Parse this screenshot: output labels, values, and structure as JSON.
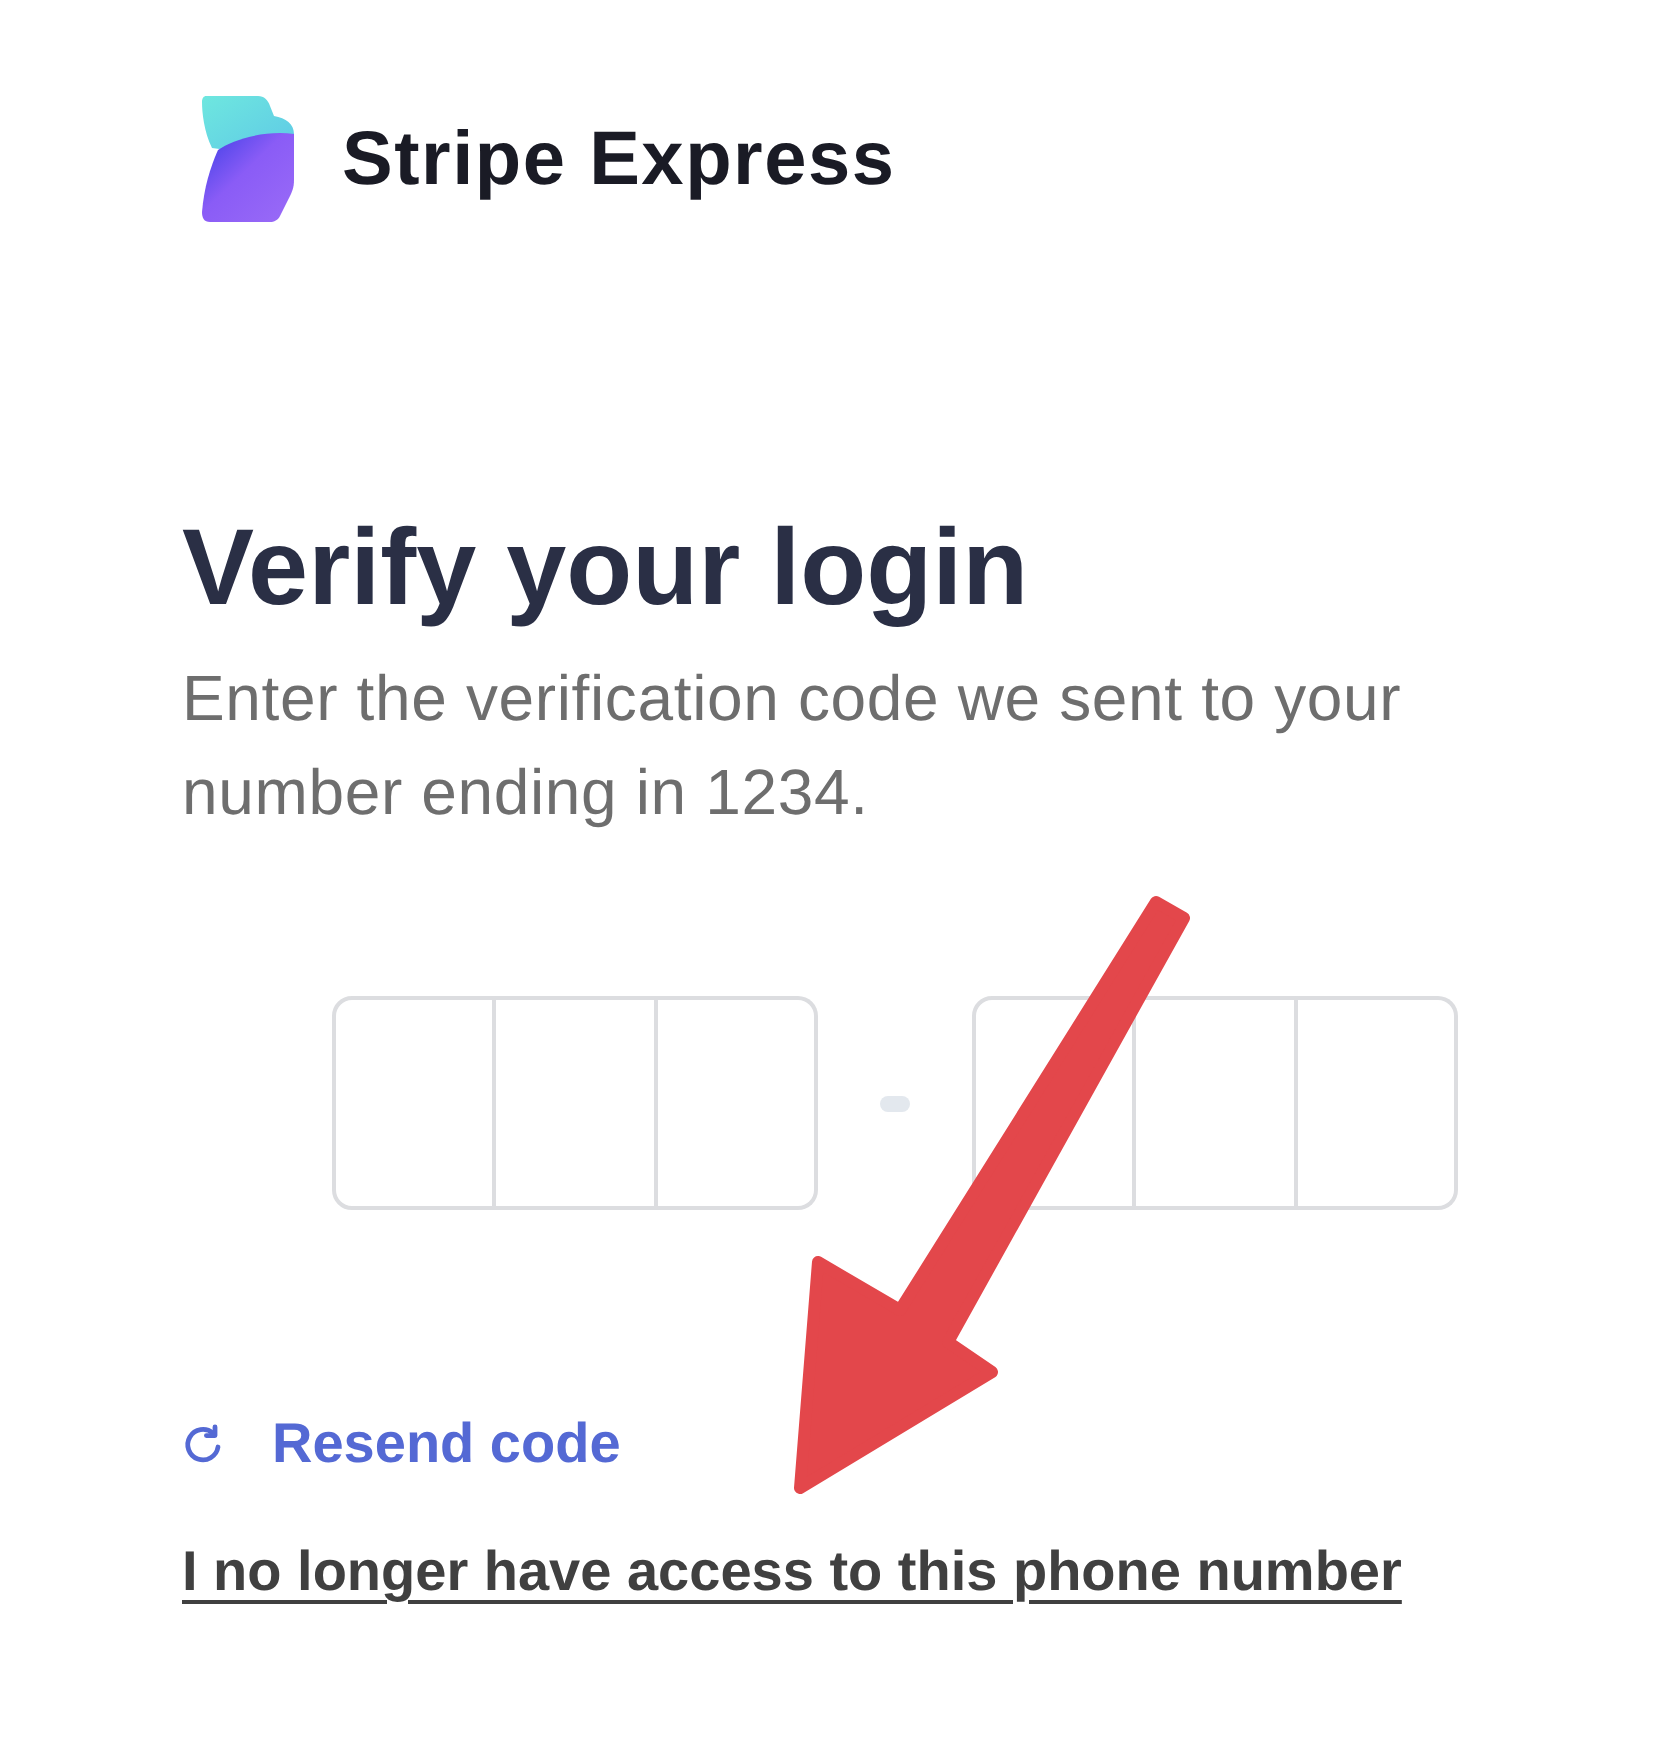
{
  "header": {
    "logo_text": "Stripe Express"
  },
  "title": "Verify your login",
  "description": "Enter the verification code we sent to your number ending in 1234.",
  "code_groups": [
    {
      "cells": [
        {
          "kind": "digit"
        },
        {
          "kind": "digit"
        },
        {
          "kind": "digit"
        }
      ]
    },
    {
      "cells": [
        {
          "kind": "digit"
        },
        {
          "kind": "digit"
        },
        {
          "kind": "digit"
        }
      ]
    }
  ],
  "links": [
    {
      "kind": "resend",
      "label": "Resend code"
    },
    {
      "kind": "plain",
      "label": "I no longer have access to this phone number"
    }
  ],
  "annotations": [
    {
      "kind": "arrow"
    }
  ]
}
